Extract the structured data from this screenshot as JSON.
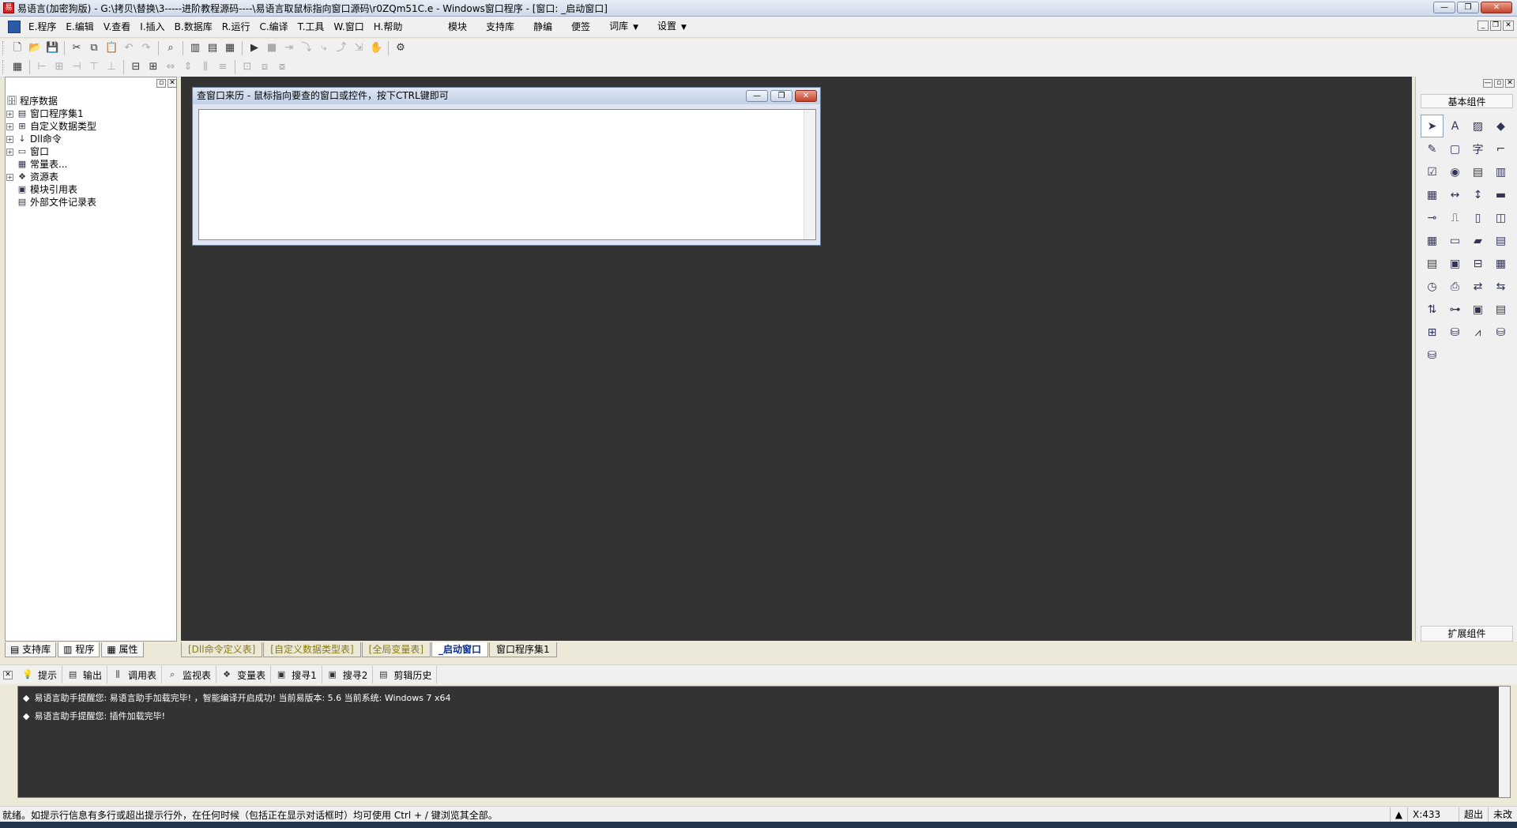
{
  "window": {
    "title": "易语言(加密狗版) - G:\\拷贝\\替换\\3-----进阶教程源码----\\易语言取鼠标指向窗口源码\\r0ZQm51C.e - Windows窗口程序 - [窗口: _启动窗口]",
    "min": "—",
    "max": "❐",
    "close": "✕"
  },
  "menu": {
    "items": [
      "E.程序",
      "E.编辑",
      "V.查看",
      "I.插入",
      "B.数据库",
      "R.运行",
      "C.编译",
      "T.工具",
      "W.窗口",
      "H.帮助"
    ],
    "right_items": [
      "模块",
      "支持库",
      "静编",
      "便签",
      "词库",
      "设置"
    ],
    "dropdown": "▼"
  },
  "tree": {
    "root": "程序数据",
    "items": [
      {
        "label": "窗口程序集1",
        "expandable": true,
        "icon": "module-icon"
      },
      {
        "label": "自定义数据类型",
        "expandable": true,
        "icon": "type-icon"
      },
      {
        "label": "Dll命令",
        "expandable": true,
        "icon": "dll-icon"
      },
      {
        "label": "窗口",
        "expandable": true,
        "icon": "window-icon"
      },
      {
        "label": "常量表...",
        "expandable": false,
        "icon": "constant-icon"
      },
      {
        "label": "资源表",
        "expandable": true,
        "icon": "resource-icon"
      },
      {
        "label": "模块引用表",
        "expandable": false,
        "icon": "module-ref-icon"
      },
      {
        "label": "外部文件记录表",
        "expandable": false,
        "icon": "file-record-icon"
      }
    ],
    "expander": "+"
  },
  "left_tabs": [
    "支持库",
    "程序",
    "属性"
  ],
  "child_window": {
    "title": "查窗口来历 - 鼠标指向要查的窗口或控件，按下CTRL键即可"
  },
  "right_panel": {
    "title": "基本组件",
    "bottom": "扩展组件"
  },
  "doc_tabs": [
    {
      "label": "[Dll命令定义表]",
      "state": "inactive"
    },
    {
      "label": "[自定义数据类型表]",
      "state": "inactive"
    },
    {
      "label": "[全局变量表]",
      "state": "inactive"
    },
    {
      "label": "_启动窗口",
      "state": "active"
    },
    {
      "label": "窗口程序集1",
      "state": "normal"
    }
  ],
  "output_tabs": [
    "提示",
    "输出",
    "调用表",
    "监视表",
    "变量表",
    "搜寻1",
    "搜寻2",
    "剪辑历史"
  ],
  "output_lines": [
    "易语言助手提醒您: 易语言助手加载完毕! ，智能编译开启成功! 当前易版本: 5.6 当前系统: Windows 7 x64",
    "易语言助手提醒您: 插件加载完毕!"
  ],
  "status": {
    "message": "就绪。如提示行信息有多行或超出提示行外，在任何时候（包括正在显示对话框时）均可使用 Ctrl + / 键浏览其全部。",
    "coord": "X:433",
    "overwrite": "超出",
    "modified": "未改"
  }
}
